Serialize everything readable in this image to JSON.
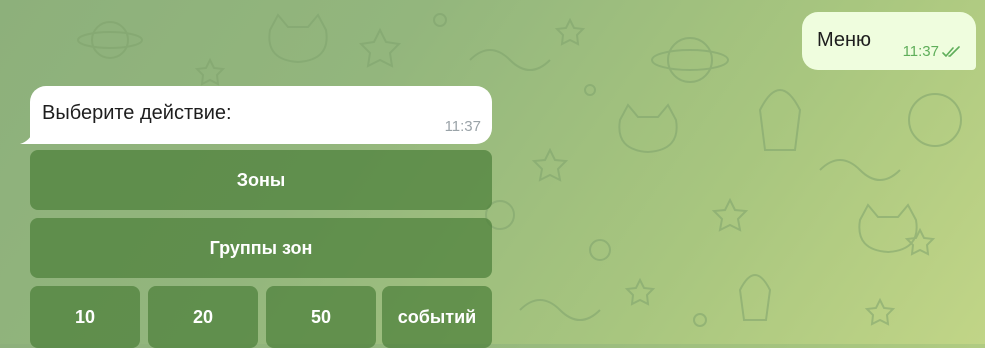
{
  "outgoing_message": {
    "text": "Меню",
    "time": "11:37",
    "status_icon": "double-check-icon"
  },
  "incoming_message": {
    "text": "Выберите действие:",
    "time": "11:37"
  },
  "keyboard": {
    "row1": [
      "Зоны"
    ],
    "row2": [
      "Группы зон"
    ],
    "row3": [
      "10",
      "20",
      "50",
      "событий"
    ]
  },
  "colors": {
    "background": "#93b67d",
    "outgoing_bubble": "#effdde",
    "incoming_bubble": "#ffffff",
    "button": "#5b8e46",
    "check": "#5fae5a"
  }
}
